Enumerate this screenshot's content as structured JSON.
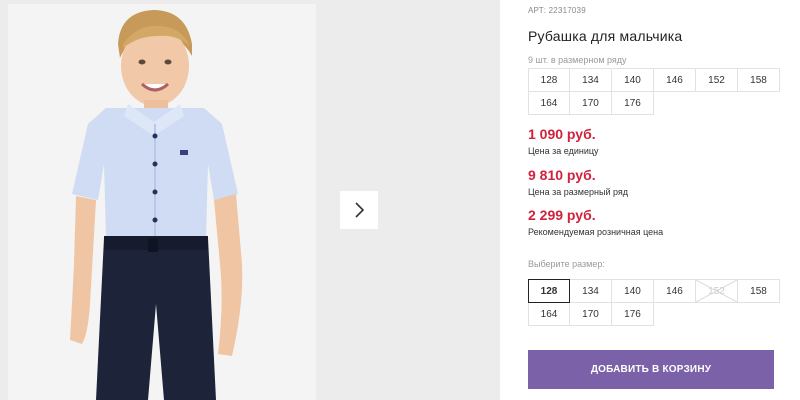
{
  "product": {
    "article": "АРТ: 22317039",
    "title": "Рубашка для мальчика",
    "image_alt": "Boy wearing light blue short-sleeve shirt and navy trousers"
  },
  "gallery": {
    "next_icon": "chevron-right-icon"
  },
  "size_row": {
    "note": "9 шт. в размерном ряду",
    "sizes": [
      "128",
      "134",
      "140",
      "146",
      "152",
      "158",
      "164",
      "170",
      "176"
    ]
  },
  "prices": {
    "unit_price": "1 090 руб.",
    "unit_label": "Цена за единицу",
    "row_price": "9 810 руб.",
    "row_label": "Цена за размерный ряд",
    "retail_price": "2 299 руб.",
    "retail_label": "Рекомендуемая розничная цена",
    "price_color": "#d0223d"
  },
  "size_picker": {
    "label": "Выберите размер:",
    "sizes": [
      "128",
      "134",
      "140",
      "146",
      "152",
      "158",
      "164",
      "170",
      "176"
    ],
    "selected": "128",
    "unavailable": [
      "152"
    ]
  },
  "cart": {
    "button_label": "ДОБАВИТЬ В КОРЗИНУ",
    "button_color": "#7b62a8"
  }
}
